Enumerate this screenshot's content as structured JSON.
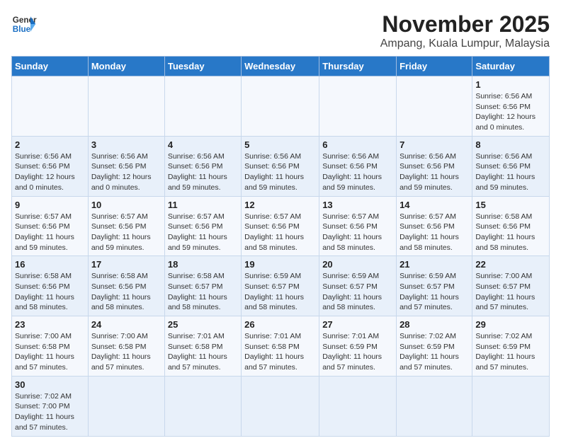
{
  "header": {
    "logo_general": "General",
    "logo_blue": "Blue",
    "month_title": "November 2025",
    "location": "Ampang, Kuala Lumpur, Malaysia"
  },
  "days_of_week": [
    "Sunday",
    "Monday",
    "Tuesday",
    "Wednesday",
    "Thursday",
    "Friday",
    "Saturday"
  ],
  "weeks": [
    [
      {
        "day": "",
        "info": ""
      },
      {
        "day": "",
        "info": ""
      },
      {
        "day": "",
        "info": ""
      },
      {
        "day": "",
        "info": ""
      },
      {
        "day": "",
        "info": ""
      },
      {
        "day": "",
        "info": ""
      },
      {
        "day": "1",
        "info": "Sunrise: 6:56 AM\nSunset: 6:56 PM\nDaylight: 12 hours\nand 0 minutes."
      }
    ],
    [
      {
        "day": "2",
        "info": "Sunrise: 6:56 AM\nSunset: 6:56 PM\nDaylight: 12 hours\nand 0 minutes."
      },
      {
        "day": "3",
        "info": "Sunrise: 6:56 AM\nSunset: 6:56 PM\nDaylight: 12 hours\nand 0 minutes."
      },
      {
        "day": "4",
        "info": "Sunrise: 6:56 AM\nSunset: 6:56 PM\nDaylight: 11 hours\nand 59 minutes."
      },
      {
        "day": "5",
        "info": "Sunrise: 6:56 AM\nSunset: 6:56 PM\nDaylight: 11 hours\nand 59 minutes."
      },
      {
        "day": "6",
        "info": "Sunrise: 6:56 AM\nSunset: 6:56 PM\nDaylight: 11 hours\nand 59 minutes."
      },
      {
        "day": "7",
        "info": "Sunrise: 6:56 AM\nSunset: 6:56 PM\nDaylight: 11 hours\nand 59 minutes."
      },
      {
        "day": "8",
        "info": "Sunrise: 6:56 AM\nSunset: 6:56 PM\nDaylight: 11 hours\nand 59 minutes."
      }
    ],
    [
      {
        "day": "9",
        "info": "Sunrise: 6:57 AM\nSunset: 6:56 PM\nDaylight: 11 hours\nand 59 minutes."
      },
      {
        "day": "10",
        "info": "Sunrise: 6:57 AM\nSunset: 6:56 PM\nDaylight: 11 hours\nand 59 minutes."
      },
      {
        "day": "11",
        "info": "Sunrise: 6:57 AM\nSunset: 6:56 PM\nDaylight: 11 hours\nand 59 minutes."
      },
      {
        "day": "12",
        "info": "Sunrise: 6:57 AM\nSunset: 6:56 PM\nDaylight: 11 hours\nand 58 minutes."
      },
      {
        "day": "13",
        "info": "Sunrise: 6:57 AM\nSunset: 6:56 PM\nDaylight: 11 hours\nand 58 minutes."
      },
      {
        "day": "14",
        "info": "Sunrise: 6:57 AM\nSunset: 6:56 PM\nDaylight: 11 hours\nand 58 minutes."
      },
      {
        "day": "15",
        "info": "Sunrise: 6:58 AM\nSunset: 6:56 PM\nDaylight: 11 hours\nand 58 minutes."
      }
    ],
    [
      {
        "day": "16",
        "info": "Sunrise: 6:58 AM\nSunset: 6:56 PM\nDaylight: 11 hours\nand 58 minutes."
      },
      {
        "day": "17",
        "info": "Sunrise: 6:58 AM\nSunset: 6:56 PM\nDaylight: 11 hours\nand 58 minutes."
      },
      {
        "day": "18",
        "info": "Sunrise: 6:58 AM\nSunset: 6:57 PM\nDaylight: 11 hours\nand 58 minutes."
      },
      {
        "day": "19",
        "info": "Sunrise: 6:59 AM\nSunset: 6:57 PM\nDaylight: 11 hours\nand 58 minutes."
      },
      {
        "day": "20",
        "info": "Sunrise: 6:59 AM\nSunset: 6:57 PM\nDaylight: 11 hours\nand 58 minutes."
      },
      {
        "day": "21",
        "info": "Sunrise: 6:59 AM\nSunset: 6:57 PM\nDaylight: 11 hours\nand 57 minutes."
      },
      {
        "day": "22",
        "info": "Sunrise: 7:00 AM\nSunset: 6:57 PM\nDaylight: 11 hours\nand 57 minutes."
      }
    ],
    [
      {
        "day": "23",
        "info": "Sunrise: 7:00 AM\nSunset: 6:58 PM\nDaylight: 11 hours\nand 57 minutes."
      },
      {
        "day": "24",
        "info": "Sunrise: 7:00 AM\nSunset: 6:58 PM\nDaylight: 11 hours\nand 57 minutes."
      },
      {
        "day": "25",
        "info": "Sunrise: 7:01 AM\nSunset: 6:58 PM\nDaylight: 11 hours\nand 57 minutes."
      },
      {
        "day": "26",
        "info": "Sunrise: 7:01 AM\nSunset: 6:58 PM\nDaylight: 11 hours\nand 57 minutes."
      },
      {
        "day": "27",
        "info": "Sunrise: 7:01 AM\nSunset: 6:59 PM\nDaylight: 11 hours\nand 57 minutes."
      },
      {
        "day": "28",
        "info": "Sunrise: 7:02 AM\nSunset: 6:59 PM\nDaylight: 11 hours\nand 57 minutes."
      },
      {
        "day": "29",
        "info": "Sunrise: 7:02 AM\nSunset: 6:59 PM\nDaylight: 11 hours\nand 57 minutes."
      }
    ],
    [
      {
        "day": "30",
        "info": "Sunrise: 7:02 AM\nSunset: 7:00 PM\nDaylight: 11 hours\nand 57 minutes."
      },
      {
        "day": "",
        "info": ""
      },
      {
        "day": "",
        "info": ""
      },
      {
        "day": "",
        "info": ""
      },
      {
        "day": "",
        "info": ""
      },
      {
        "day": "",
        "info": ""
      },
      {
        "day": "",
        "info": ""
      }
    ]
  ]
}
